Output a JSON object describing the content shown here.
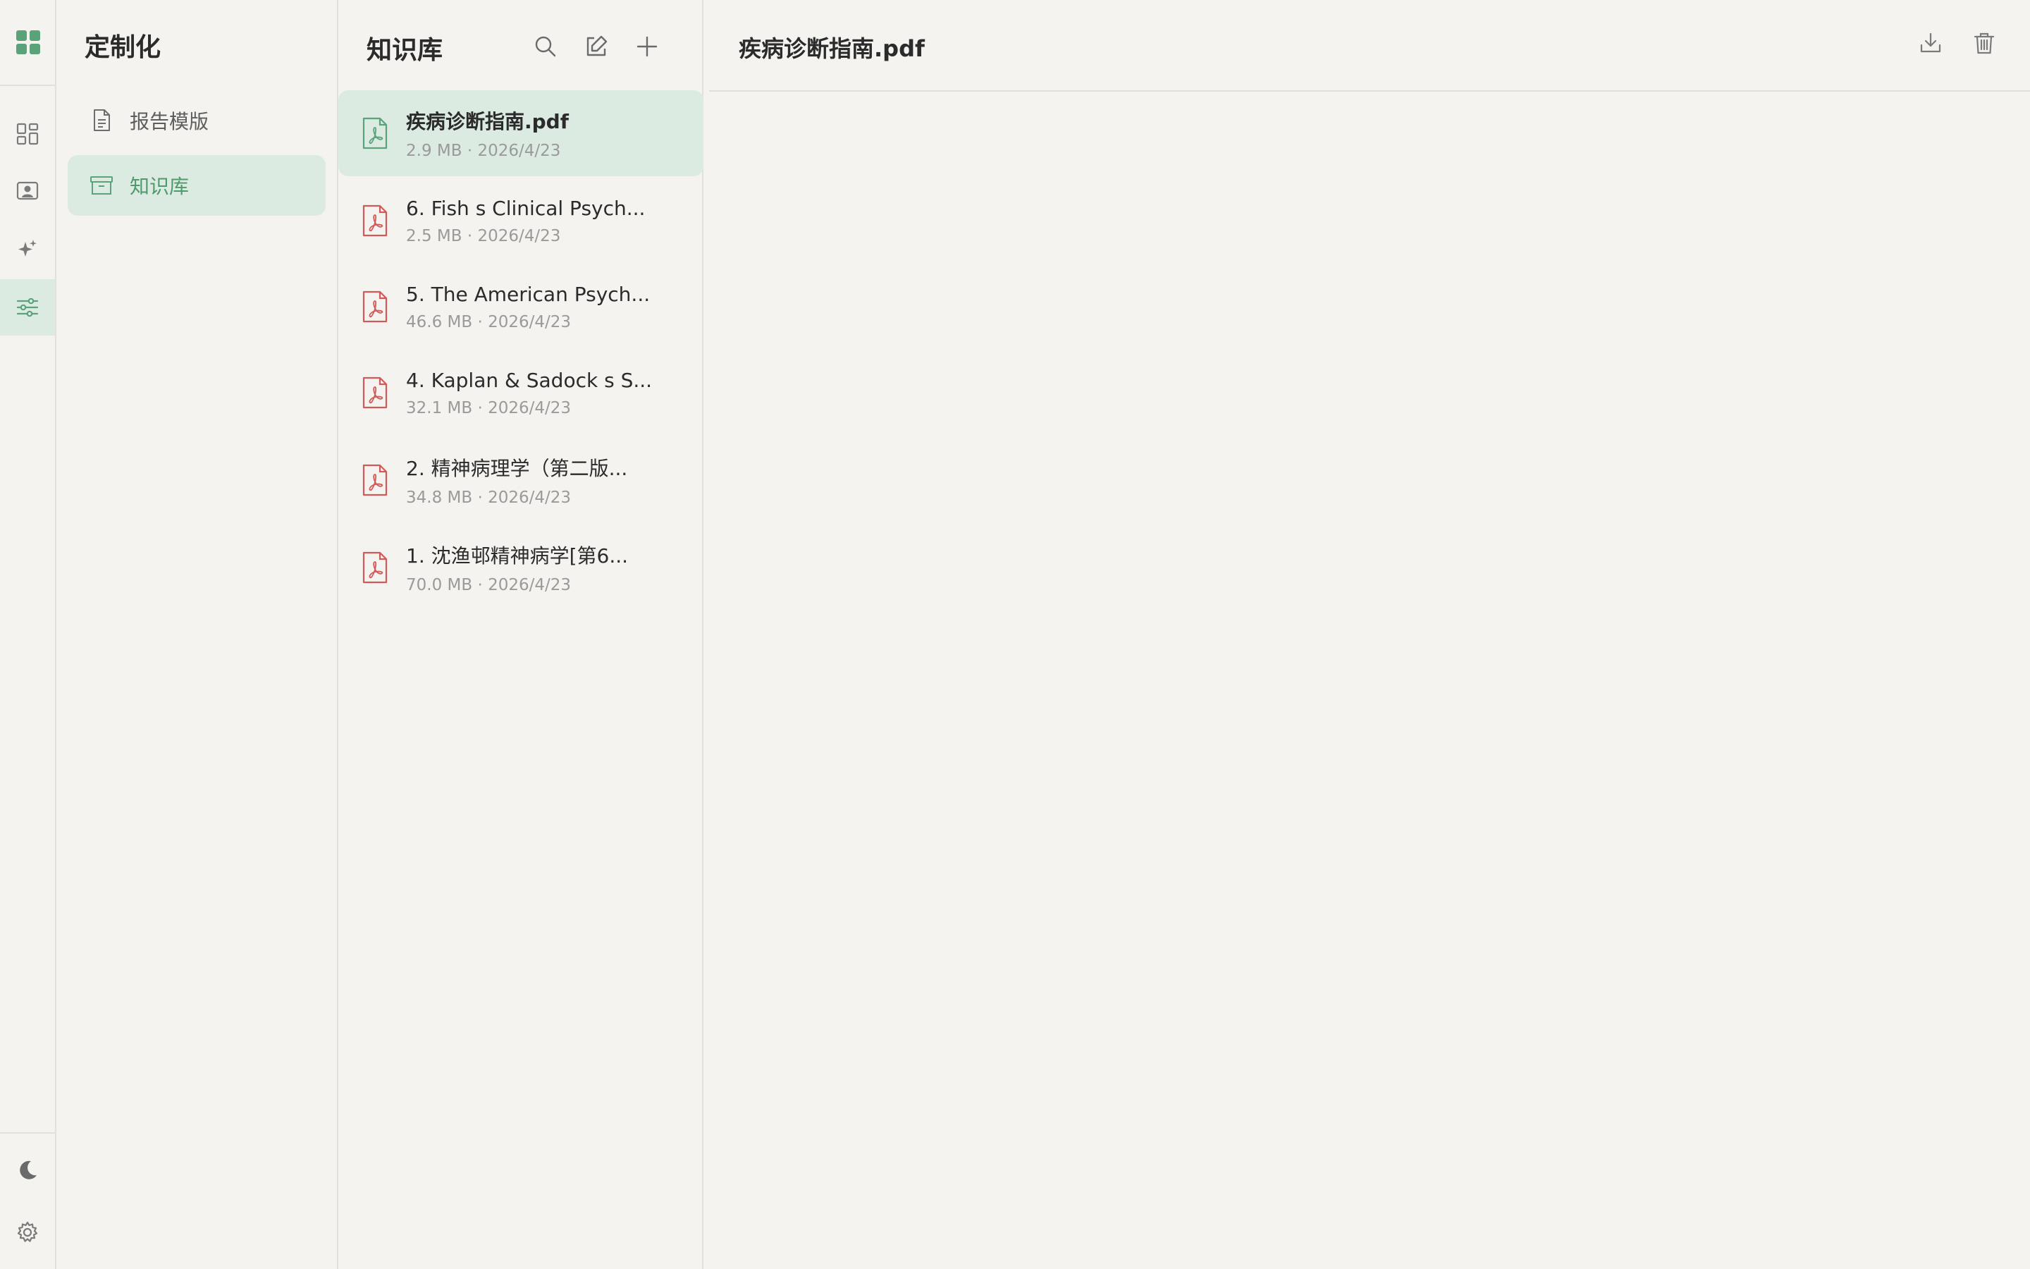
{
  "rail": {
    "logo_icon": "grid-logo-icon",
    "items": [
      {
        "icon": "dashboard-icon",
        "active": false
      },
      {
        "icon": "patient-icon",
        "active": false
      },
      {
        "icon": "sparkle-icon",
        "active": false
      },
      {
        "icon": "sliders-icon",
        "active": true
      }
    ],
    "bottom": [
      {
        "icon": "moon-icon"
      },
      {
        "icon": "gear-icon"
      }
    ]
  },
  "sidebar": {
    "title": "定制化",
    "items": [
      {
        "label": "报告模版",
        "icon": "document-icon",
        "active": false
      },
      {
        "label": "知识库",
        "icon": "archive-icon",
        "active": true
      }
    ]
  },
  "knowledge": {
    "title": "知识库",
    "tools": [
      "search-icon",
      "edit-icon",
      "plus-icon"
    ],
    "files": [
      {
        "name": "疾病诊断指南.pdf",
        "meta": "2.9 MB · 2026/4/23",
        "active": true
      },
      {
        "name": "6. Fish s Clinical Psych...",
        "meta": "2.5 MB · 2026/4/23",
        "active": false
      },
      {
        "name": "5. The American Psych...",
        "meta": "46.6 MB · 2026/4/23",
        "active": false
      },
      {
        "name": "4. Kaplan & Sadock s S...",
        "meta": "32.1 MB · 2026/4/23",
        "active": false
      },
      {
        "name": "2. 精神病理学（第二版...",
        "meta": "34.8 MB · 2026/4/23",
        "active": false
      },
      {
        "name": "1. 沈渔邨精神病学[第6...",
        "meta": "70.0 MB · 2026/4/23",
        "active": false
      }
    ]
  },
  "viewer": {
    "title": "疾病诊断指南.pdf",
    "actions": [
      "download-icon",
      "trash-icon"
    ]
  },
  "colors": {
    "accent": "#5aa27a",
    "accent_bg": "#dcebe1",
    "pdf_red": "#d05a5a",
    "background": "#f4f3ef"
  }
}
